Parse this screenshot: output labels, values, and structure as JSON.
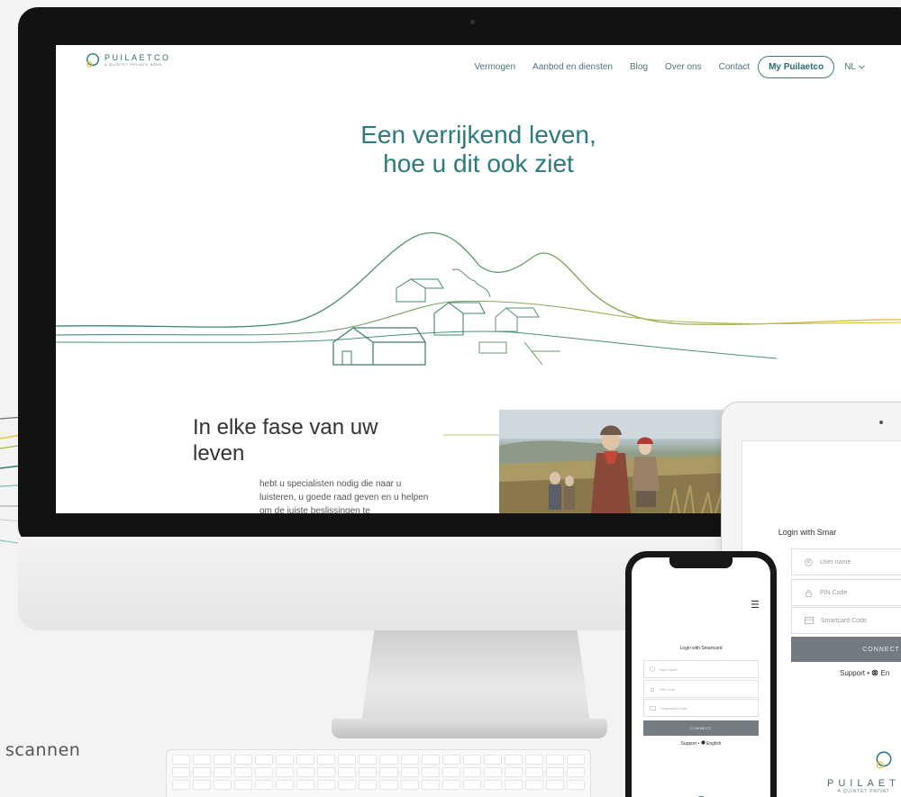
{
  "caption": "scannen",
  "website": {
    "logo": {
      "name": "PUILAETCO",
      "tagline": "A QUINTET PRIVATE BANK"
    },
    "nav": {
      "items": [
        "Vermogen",
        "Aanbod en diensten",
        "Blog",
        "Over ons",
        "Contact"
      ],
      "cta": "My Puilaetco",
      "language": "NL"
    },
    "hero": {
      "line1": "Een verrijkend leven,",
      "line2": "hoe u dit ook ziet"
    },
    "section": {
      "heading_line1": "In elke fase van uw",
      "heading_line2": "leven",
      "body": "hebt u specialisten nodig die naar u luisteren, u goede raad geven en u helpen om de juiste beslissingen te"
    }
  },
  "tablet": {
    "title": "Login with Smar",
    "fields": [
      {
        "icon": "user-icon",
        "label": "User name"
      },
      {
        "icon": "lock-icon",
        "label": "PIN Code"
      },
      {
        "icon": "card-icon",
        "label": "Smartcard Code"
      }
    ],
    "connect": "CONNECT",
    "support": "Support",
    "language": "En",
    "logo": {
      "name": "PUILAET",
      "tagline": "A QUINTET PRIVAT"
    }
  },
  "phone": {
    "title": "Login with Smartcard",
    "fields": [
      {
        "icon": "user-icon",
        "label": "User name"
      },
      {
        "icon": "lock-icon",
        "label": "PIN Code"
      },
      {
        "icon": "card-icon",
        "label": "Smartcard Code"
      }
    ],
    "connect": "CONNECT",
    "support": "Support",
    "language": "English"
  },
  "colors": {
    "brand_teal": "#2d7a7c",
    "accent_yellow": "#e8c23a",
    "connect_gray": "#737b80",
    "background": "#f3f3f2"
  }
}
